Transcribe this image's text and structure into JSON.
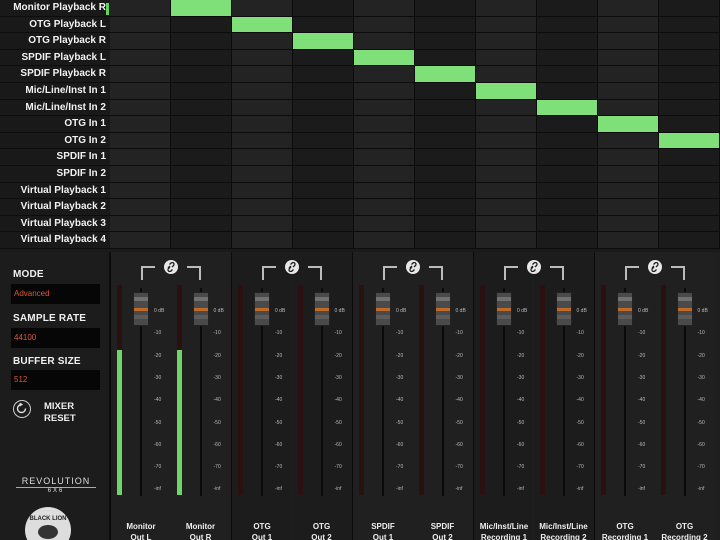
{
  "matrix": {
    "rows": [
      "Monitor Playback R",
      "OTG Playback L",
      "OTG Playback R",
      "SPDIF Playback L",
      "SPDIF Playback R",
      "Mic/Line/Inst In 1",
      "Mic/Line/Inst In 2",
      "OTG In 1",
      "OTG In 2",
      "SPDIF In 1",
      "SPDIF In 2",
      "Virtual Playback 1",
      "Virtual Playback 2",
      "Virtual Playback 3",
      "Virtual Playback 4"
    ],
    "columns": 10,
    "active": [
      [
        0,
        1
      ],
      [
        1,
        2
      ],
      [
        2,
        3
      ],
      [
        3,
        4
      ],
      [
        4,
        5
      ],
      [
        5,
        6
      ],
      [
        6,
        7
      ],
      [
        7,
        8
      ],
      [
        8,
        9
      ]
    ]
  },
  "settings": {
    "mode_label": "MODE",
    "mode_value": "Advanced",
    "sample_rate_label": "SAMPLE RATE",
    "sample_rate_value": "44100",
    "buffer_size_label": "BUFFER SIZE",
    "buffer_size_value": "512",
    "reset_label_1": "MIXER",
    "reset_label_2": "RESET",
    "logo_text": "REVOLUTION",
    "logo_sub": "6X6",
    "seal_text": "BLACK LION"
  },
  "scale": [
    "0 dB",
    "-10",
    "-20",
    "-30",
    "-40",
    "-50",
    "-60",
    "-70",
    "-inf"
  ],
  "strips": [
    {
      "line1": "Monitor",
      "line2": "Out L",
      "level": 0.69
    },
    {
      "line1": "Monitor",
      "line2": "Out R",
      "level": 0.69
    },
    {
      "line1": "OTG",
      "line2": "Out 1",
      "level": 0
    },
    {
      "line1": "OTG",
      "line2": "Out 2",
      "level": 0
    },
    {
      "line1": "SPDIF",
      "line2": "Out 1",
      "level": 0
    },
    {
      "line1": "SPDIF",
      "line2": "Out 2",
      "level": 0
    },
    {
      "line1": "Mic/Inst/Line",
      "line2": "Recording 1",
      "level": 0
    },
    {
      "line1": "Mic/Inst/Line",
      "line2": "Recording 2",
      "level": 0
    },
    {
      "line1": "OTG",
      "line2": "Recording 1",
      "level": 0
    },
    {
      "line1": "OTG",
      "line2": "Recording 2",
      "level": 0
    }
  ],
  "colors": {
    "active": "#7fe07a",
    "meter": "#6fd569",
    "value_text": "#d95a3a"
  }
}
